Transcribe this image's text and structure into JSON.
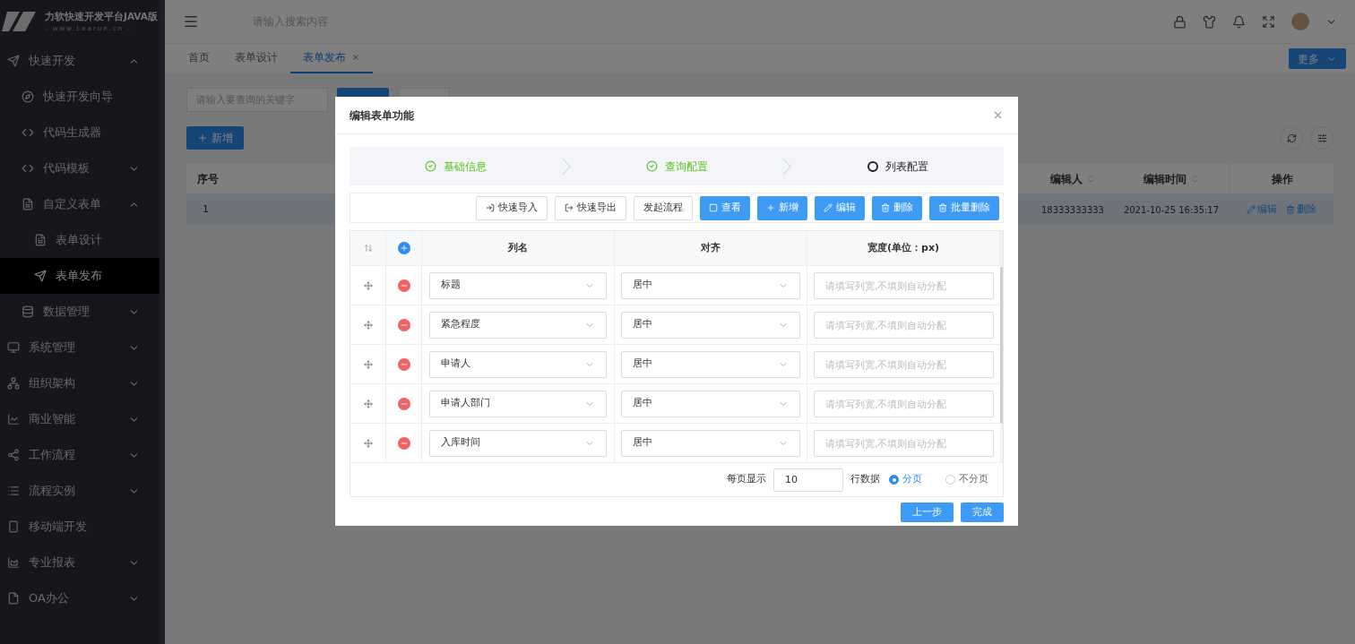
{
  "sidebar": {
    "logo": {
      "title": "力软快速开发平台JAVA版",
      "subtitle": "- www.Learun.cn -"
    },
    "items": [
      {
        "label": "快速开发",
        "selected": false,
        "expanded": true,
        "children": [
          {
            "label": "快速开发向导",
            "selected": false
          },
          {
            "label": "代码生成器",
            "selected": false
          },
          {
            "label": "代码模板",
            "selected": false,
            "expanded": false
          },
          {
            "label": "自定义表单",
            "selected": false,
            "expanded": true,
            "children": [
              {
                "label": "表单设计",
                "selected": false
              },
              {
                "label": "表单发布",
                "selected": true
              }
            ]
          },
          {
            "label": "数据管理",
            "selected": false,
            "expanded": false
          }
        ]
      },
      {
        "label": "系统管理",
        "selected": false,
        "expanded": false
      },
      {
        "label": "组织架构",
        "selected": false,
        "expanded": false
      },
      {
        "label": "商业智能",
        "selected": false,
        "expanded": false
      },
      {
        "label": "工作流程",
        "selected": false,
        "expanded": false
      },
      {
        "label": "流程实例",
        "selected": false,
        "expanded": false
      },
      {
        "label": "移动端开发",
        "selected": false
      },
      {
        "label": "专业报表",
        "selected": false,
        "expanded": false
      },
      {
        "label": "OA办公",
        "selected": false,
        "expanded": false
      }
    ]
  },
  "header": {
    "search": {
      "placeholder": "请输入搜索内容"
    }
  },
  "tabs": [
    {
      "label": "首页",
      "selected": false,
      "closable": false
    },
    {
      "label": "表单设计",
      "selected": false,
      "closable": false
    },
    {
      "label": "表单发布",
      "selected": true,
      "closable": true
    }
  ],
  "more_button": "更多",
  "page": {
    "search": {
      "placeholder": "请输入要查询的关键字"
    },
    "add_button": "新增",
    "table": {
      "columns": [
        {
          "label": "序号",
          "sortable": false
        },
        {
          "label": "编辑人",
          "sortable": true
        },
        {
          "label": "编辑时间",
          "sortable": true
        },
        {
          "label": "操作",
          "sortable": false
        }
      ],
      "rows": [
        {
          "index": "1",
          "editor": "18333333333",
          "time": "2021-10-25 16:35:17",
          "actions": [
            "编辑",
            "删除"
          ]
        }
      ]
    }
  },
  "dialog": {
    "title": "编辑表单功能",
    "steps": [
      {
        "label": "基础信息",
        "completed": true
      },
      {
        "label": "查询配置",
        "completed": true
      },
      {
        "label": "列表配置",
        "completed": false
      }
    ],
    "toolbar": [
      {
        "label": "快速导入",
        "kind": "plain"
      },
      {
        "label": "快速导出",
        "kind": "plain"
      },
      {
        "label": "发起流程",
        "kind": "plain"
      },
      {
        "label": "查看",
        "kind": "primary"
      },
      {
        "label": "新增",
        "kind": "primary"
      },
      {
        "label": "编辑",
        "kind": "primary"
      },
      {
        "label": "删除",
        "kind": "primary"
      },
      {
        "label": "批量删除",
        "kind": "primary"
      }
    ],
    "columns": [
      "列名",
      "对齐",
      "宽度(单位：px)"
    ],
    "rows": [
      {
        "name": "标题",
        "align": "居中",
        "width_placeholder": "请填写列宽,不填则自动分配"
      },
      {
        "name": "紧急程度",
        "align": "居中",
        "width_placeholder": "请填写列宽,不填则自动分配"
      },
      {
        "name": "申请人",
        "align": "居中",
        "width_placeholder": "请填写列宽,不填则自动分配"
      },
      {
        "name": "申请人部门",
        "align": "居中",
        "width_placeholder": "请填写列宽,不填则自动分配"
      },
      {
        "name": "入库时间",
        "align": "居中",
        "width_placeholder": "请填写列宽,不填则自动分配"
      }
    ],
    "footer": {
      "page_size_label": "每页显示",
      "page_size": "10",
      "rows_label": "行数据",
      "paging": [
        {
          "label": "分页",
          "selected": true
        },
        {
          "label": "不分页",
          "selected": false
        }
      ]
    },
    "buttons": [
      "上一步",
      "完成"
    ]
  }
}
